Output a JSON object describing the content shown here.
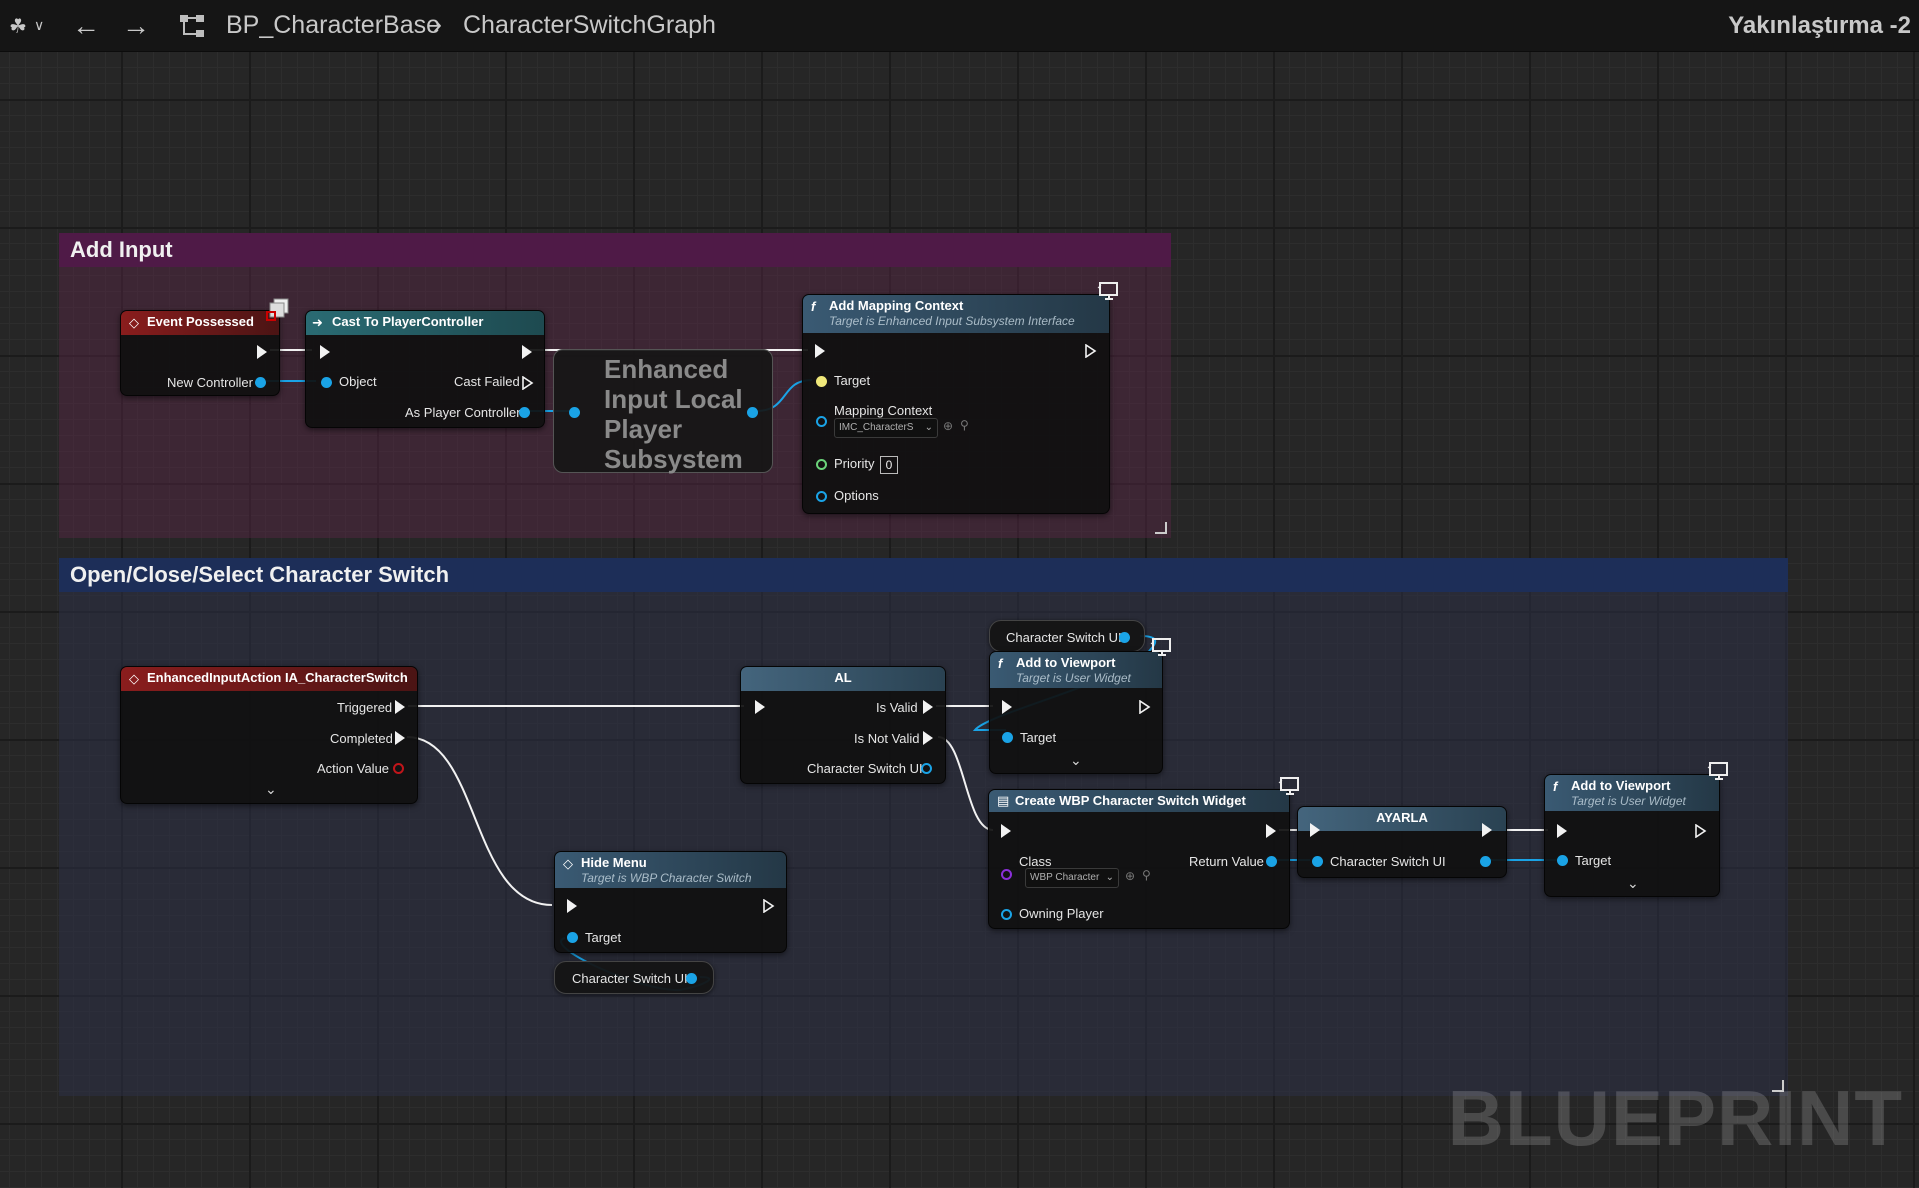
{
  "toolbar": {
    "breadcrumb_blueprint": "BP_CharacterBase",
    "breadcrumb_graph": "CharacterSwitchGraph",
    "zoom_label": "Yakınlaştırma -2"
  },
  "comments": {
    "add_input": "Add Input",
    "switch": "Open/Close/Select Character Switch"
  },
  "nodes": {
    "event_possessed": {
      "title": "Event Possessed",
      "pin_new_controller": "New Controller"
    },
    "cast": {
      "title": "Cast To PlayerController",
      "pin_object": "Object",
      "pin_cast_failed": "Cast Failed",
      "pin_as_pc": "As Player Controller"
    },
    "subsystem": {
      "line1": "Enhanced",
      "line2": "Input Local",
      "line3": "Player",
      "line4": "Subsystem"
    },
    "add_mapping": {
      "title": "Add Mapping Context",
      "subtitle": "Target is Enhanced Input Subsystem Interface",
      "pin_target": "Target",
      "pin_mapping": "Mapping Context",
      "mapping_value": "IMC_CharacterS",
      "pin_priority": "Priority",
      "priority_value": "0",
      "pin_options": "Options"
    },
    "input_action": {
      "title": "EnhancedInputAction IA_CharacterSwitch",
      "pin_triggered": "Triggered",
      "pin_completed": "Completed",
      "pin_action_value": "Action Value"
    },
    "al": {
      "title": "AL",
      "pin_is_valid": "Is Valid",
      "pin_is_not_valid": "Is Not Valid",
      "pin_var": "Character Switch UI"
    },
    "var_top": {
      "label": "Character Switch UI"
    },
    "add_viewport_1": {
      "title": "Add to Viewport",
      "subtitle": "Target is User Widget",
      "pin_target": "Target"
    },
    "create_widget": {
      "title": "Create WBP Character Switch Widget",
      "pin_class": "Class",
      "class_value": "WBP Character",
      "pin_return": "Return Value",
      "pin_owner": "Owning Player"
    },
    "ayarla": {
      "title": "AYARLA",
      "pin_var": "Character Switch UI"
    },
    "add_viewport_2": {
      "title": "Add to Viewport",
      "subtitle": "Target is User Widget",
      "pin_target": "Target"
    },
    "hide_menu": {
      "title": "Hide Menu",
      "subtitle": "Target is WBP Character Switch",
      "pin_target": "Target"
    },
    "var_bottom": {
      "label": "Character Switch UI"
    }
  },
  "watermark": "BLUEPRINT",
  "colors": {
    "exec": "#f2f2f2",
    "object_pin": "#1aa3e6",
    "event_header": "#8a1d1d",
    "comment_purple": "#4f1a47",
    "comment_blue": "#1d2e58"
  }
}
